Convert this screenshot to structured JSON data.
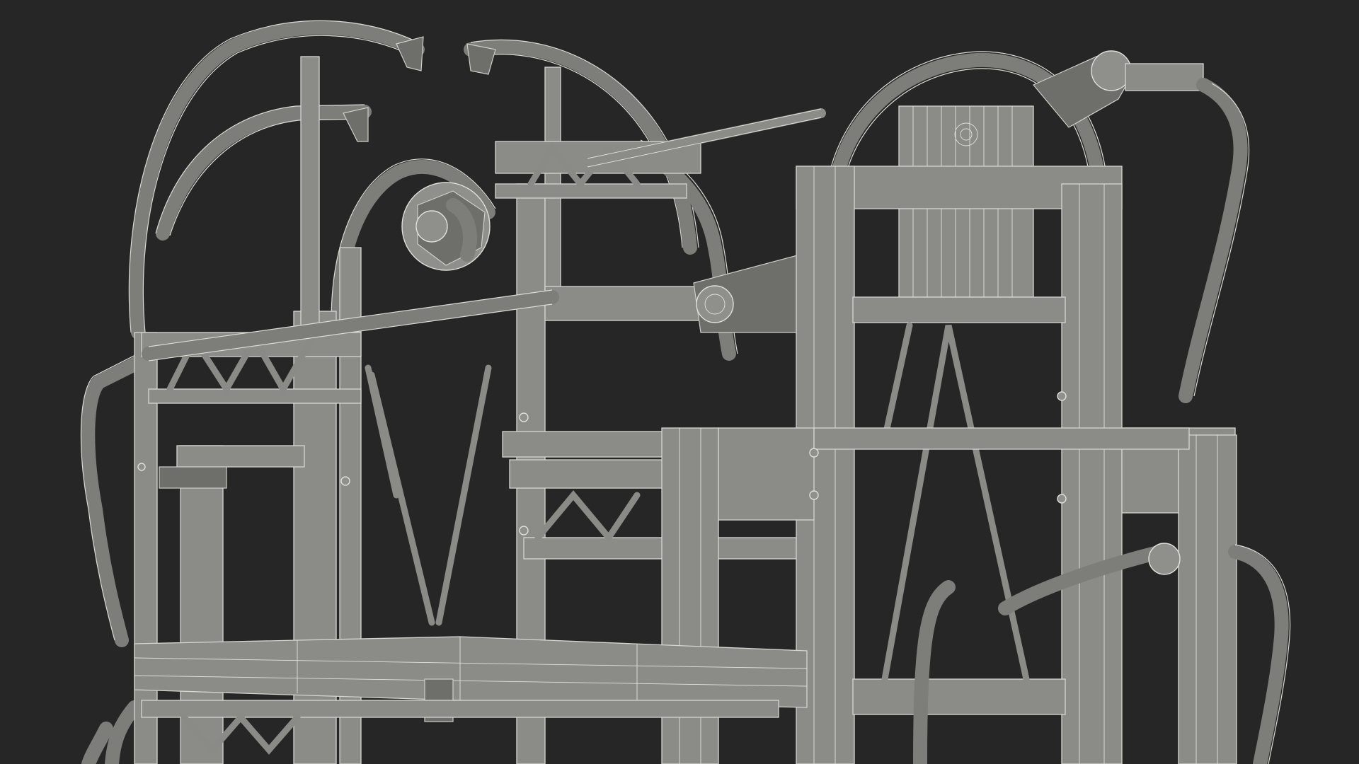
{
  "scene": {
    "subject": "",
    "background_color": "#262626",
    "wireframe_fill": "#8b8b87",
    "wireframe_line": "#d6d6cf"
  }
}
